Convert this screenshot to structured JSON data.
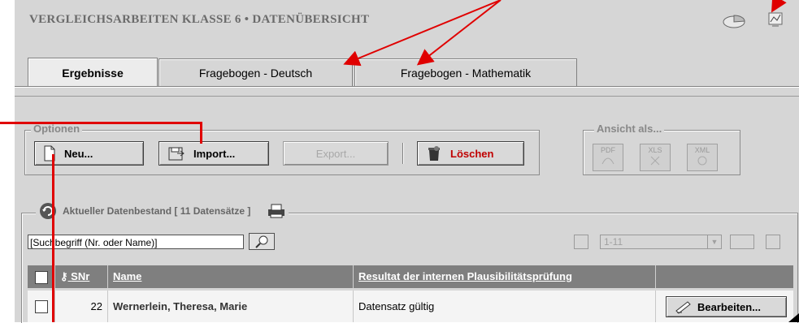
{
  "page": {
    "title": "VERGLEICHSARBEITEN KLASSE 6 •  DATENÜBERSICHT"
  },
  "tabs": [
    {
      "label": "Ergebnisse",
      "active": true
    },
    {
      "label": "Fragebogen - Deutsch",
      "active": false
    },
    {
      "label": "Fragebogen - Mathematik",
      "active": false
    }
  ],
  "options": {
    "legend": "Optionen",
    "new_label": "Neu...",
    "import_label": "Import...",
    "export_label": "Export...",
    "delete_label": "Löschen"
  },
  "view_as": {
    "legend": "Ansicht als...",
    "formats": [
      "PDF",
      "XLS",
      "XML"
    ]
  },
  "dataset": {
    "title": "Aktueller Datenbestand [ 11 Datensätze ]",
    "search_value": "[Suchbegriff (Nr. oder Name)]",
    "range": "1-11"
  },
  "table": {
    "columns": [
      "SNr",
      "Name",
      "Resultat der internen Plausibilitätsprüfung"
    ],
    "rows": [
      {
        "snr": "22",
        "name": "Wernerlein, Theresa, Marie",
        "result": "Datensatz gültig",
        "action": "Bearbeiten..."
      }
    ]
  },
  "colors": {
    "annotation_arrow": "#e00000",
    "delete_text": "#c00000"
  }
}
